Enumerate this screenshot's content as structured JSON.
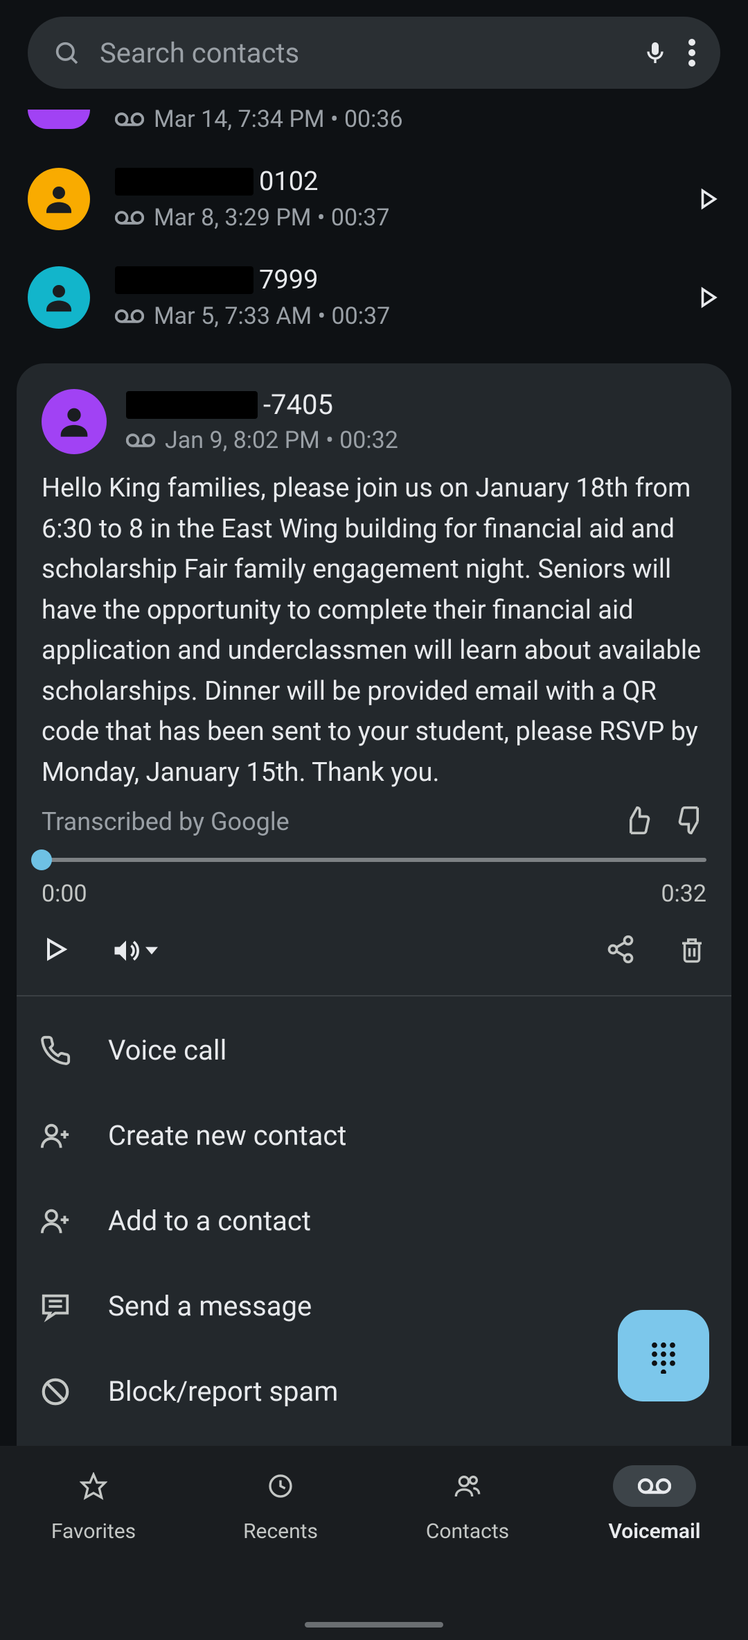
{
  "search": {
    "placeholder": "Search contacts"
  },
  "partial": {
    "sub": "Mar 14, 7:34 PM • 00:36"
  },
  "items": [
    {
      "suffix": "0102",
      "sub": "Mar 8, 3:29 PM • 00:37",
      "avatar": "yellow"
    },
    {
      "suffix": "7999",
      "sub": "Mar 5, 7:33 AM • 00:37",
      "avatar": "cyan"
    }
  ],
  "expanded": {
    "suffix": "-7405",
    "sub": "Jan 9, 8:02 PM • 00:32",
    "transcript": "Hello King families, please join us on January 18th from 6:30 to 8 in the East Wing building for financial aid and scholarship Fair family engagement night. Seniors will have the opportunity to complete their financial aid application and underclassmen will learn about available scholarships. Dinner will be provided email with a QR code that has been sent to your student, please RSVP by Monday, January 15th. Thank you.",
    "transcribed_by": "Transcribed by Google",
    "time_start": "0:00",
    "time_end": "0:32"
  },
  "actions": {
    "voice_call": "Voice call",
    "create_contact": "Create new contact",
    "add_contact": "Add to a contact",
    "send_message": "Send a message",
    "block": "Block/report spam"
  },
  "nav": {
    "favorites": "Favorites",
    "recents": "Recents",
    "contacts": "Contacts",
    "voicemail": "Voicemail"
  }
}
